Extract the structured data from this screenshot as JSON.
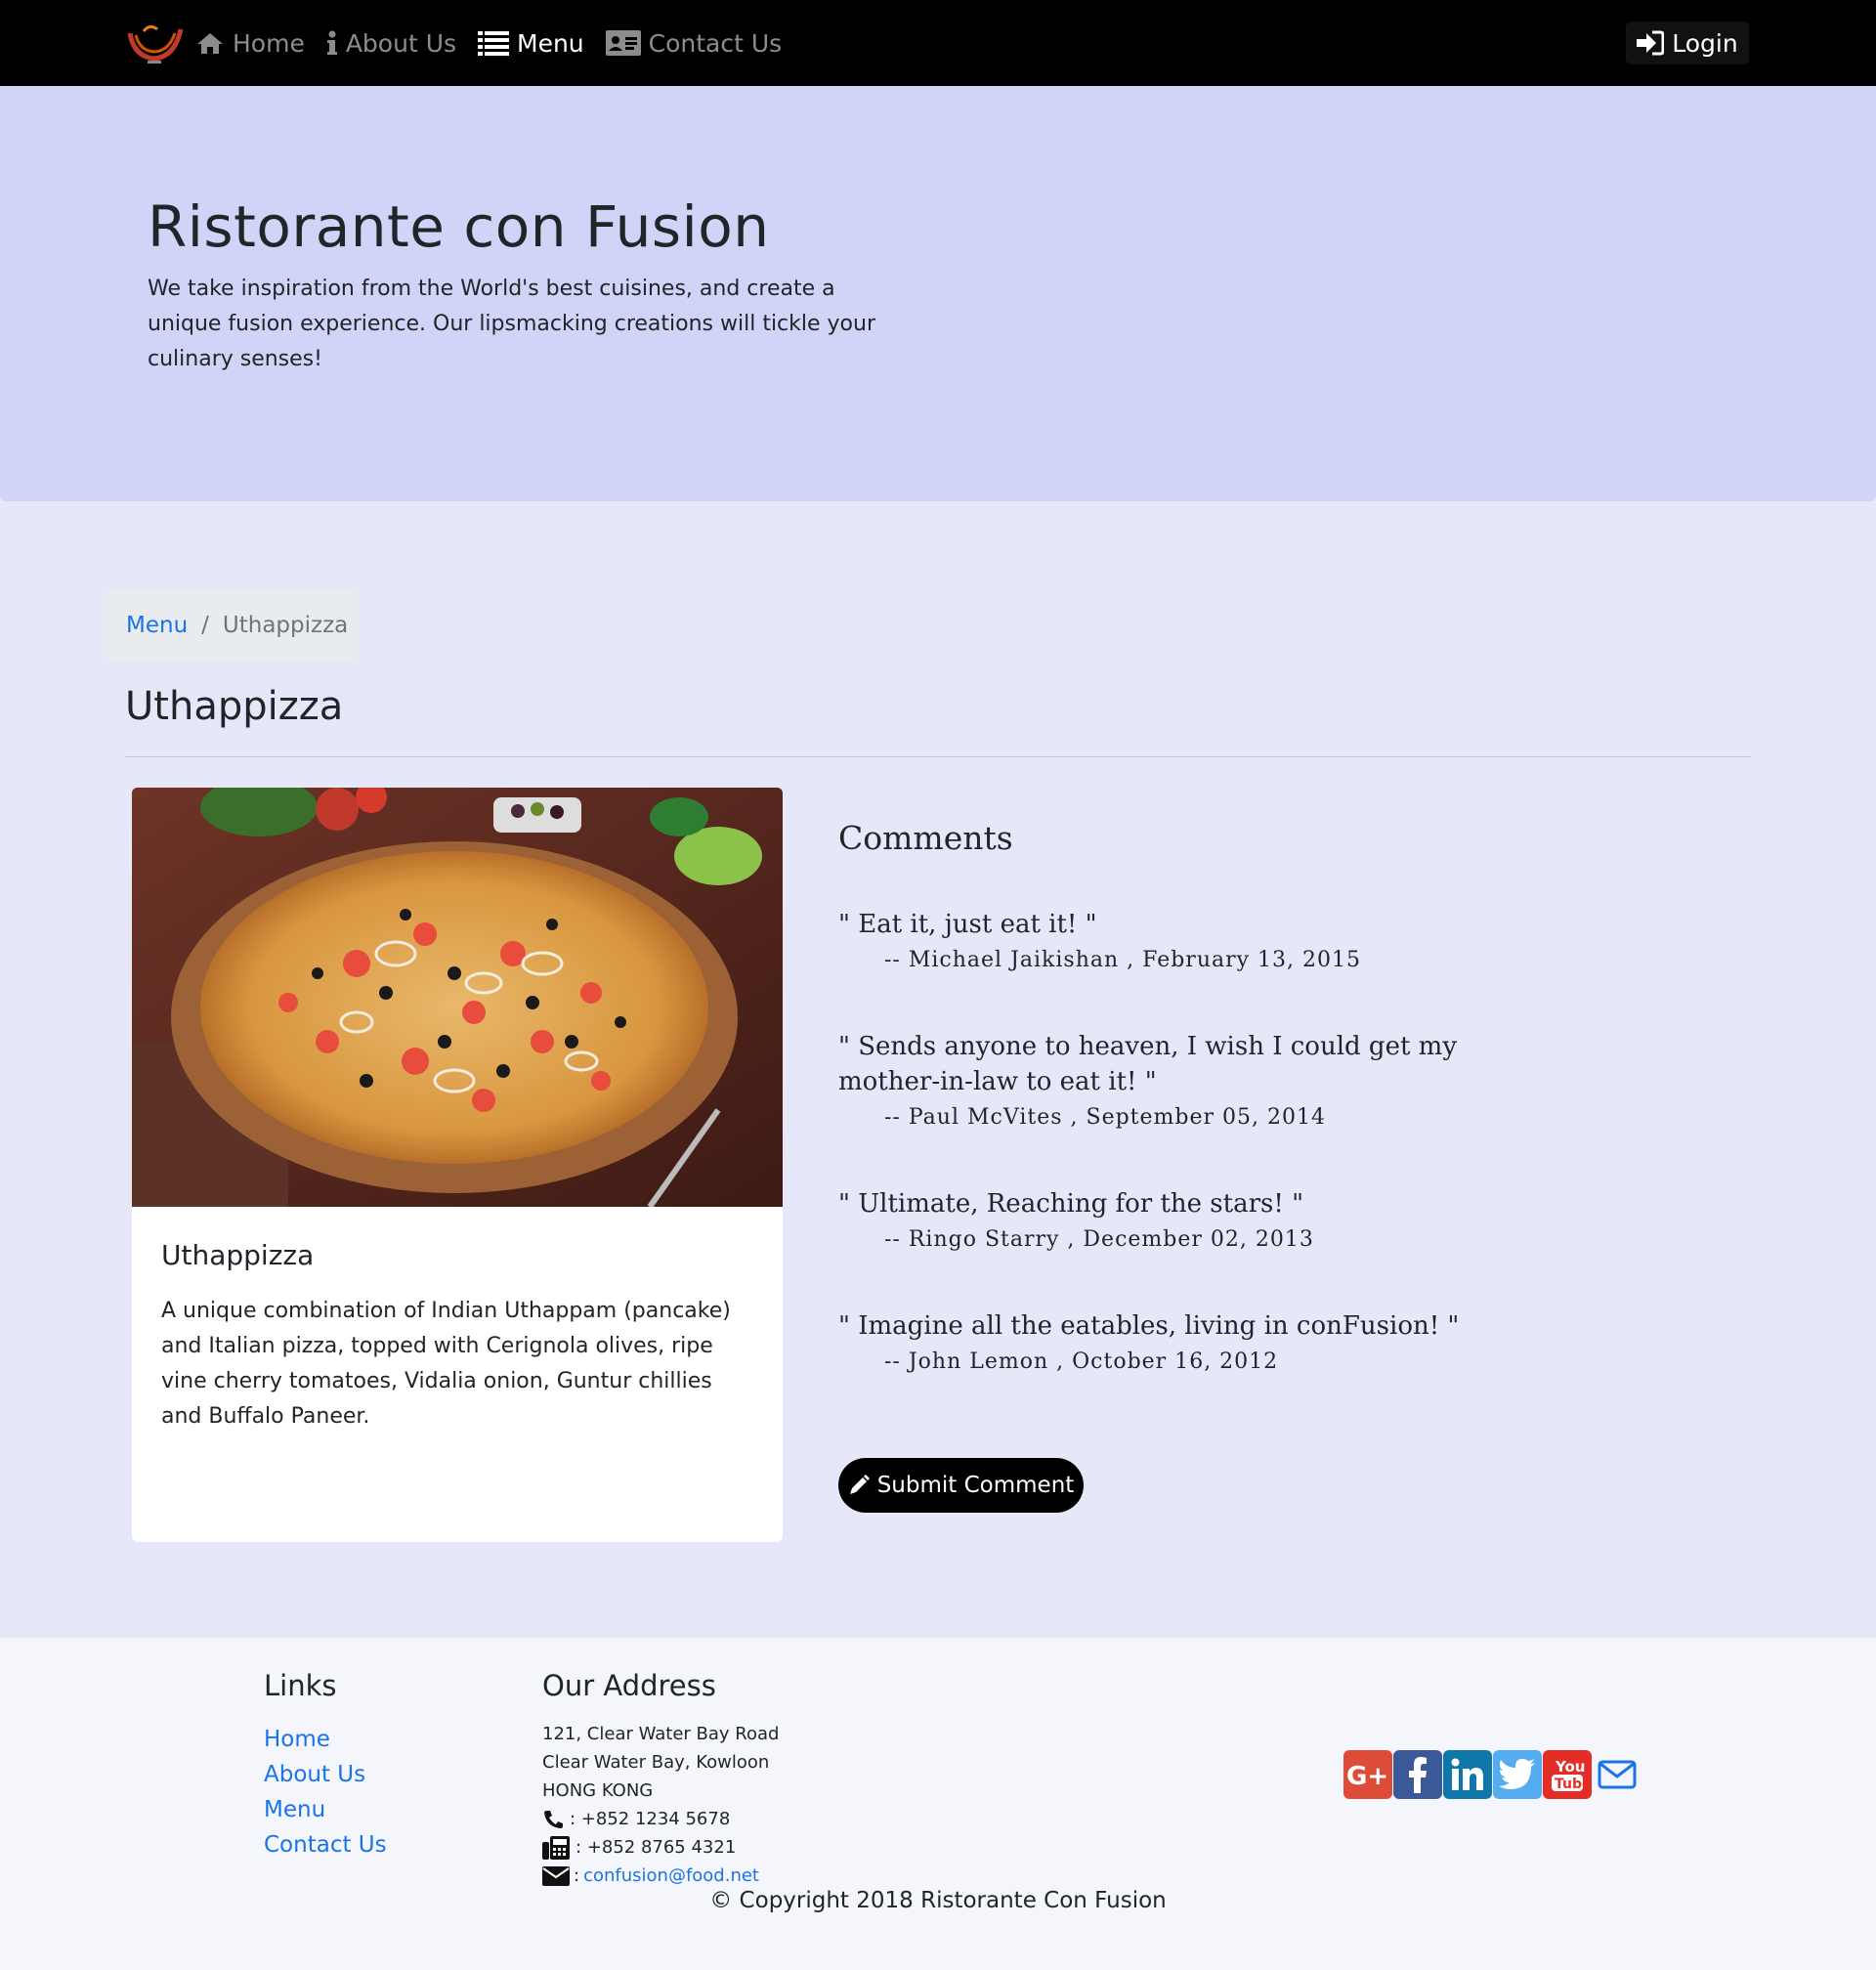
{
  "colors": {
    "navbar_bg": "#000000",
    "jumbotron_bg": "#d0d4f7",
    "page_bg": "#e6e8f9",
    "link": "#1a73e8",
    "footer_bg": "#f5f6fc"
  },
  "navbar": {
    "items": [
      {
        "label": "Home",
        "icon": "home-icon"
      },
      {
        "label": "About Us",
        "icon": "info-icon"
      },
      {
        "label": "Menu",
        "icon": "list-icon"
      },
      {
        "label": "Contact Us",
        "icon": "address-card-icon"
      }
    ],
    "active": "Menu",
    "login_label": "Login"
  },
  "jumbotron": {
    "title": "Ristorante con Fusion",
    "text": "We take inspiration from the World's best cuisines, and create a unique fusion experience. Our lipsmacking creations will tickle your culinary senses!"
  },
  "breadcrumb": {
    "parent": "Menu",
    "current": "Uthappizza"
  },
  "dish": {
    "heading": "Uthappizza",
    "card_title": "Uthappizza",
    "description": "A unique combination of Indian Uthappam (pancake) and Italian pizza, topped with Cerignola olives, ripe vine cherry tomatoes, Vidalia onion, Guntur chillies and Buffalo Paneer."
  },
  "comments": {
    "heading": "Comments",
    "items": [
      {
        "text": "\" Eat it, just eat it! \"",
        "meta": "-- Michael Jaikishan ,   February 13, 2015"
      },
      {
        "text": "\" Sends anyone to heaven, I wish I could get my mother-in-law to eat it! \"",
        "meta": "-- Paul McVites ,   September 05, 2014"
      },
      {
        "text": "\" Ultimate, Reaching for the stars! \"",
        "meta": "-- Ringo Starry ,   December 02, 2013"
      },
      {
        "text": "\" Imagine all the eatables, living in conFusion! \"",
        "meta": "-- John Lemon ,   October 16, 2012"
      }
    ],
    "submit_label": "Submit Comment"
  },
  "footer": {
    "links_heading": "Links",
    "links": [
      "Home",
      "About Us",
      "Menu",
      "Contact Us"
    ],
    "address_heading": "Our Address",
    "address_lines": [
      "121, Clear Water Bay Road",
      "Clear Water Bay, Kowloon",
      "HONG KONG"
    ],
    "phone": ": +852 1234 5678",
    "fax": ": +852 8765 4321",
    "email_prefix": ":",
    "email": "confusion@food.net",
    "social": [
      "google-plus-icon",
      "facebook-icon",
      "linkedin-icon",
      "twitter-icon",
      "youtube-icon",
      "envelope-icon"
    ],
    "copyright": "© Copyright 2018 Ristorante Con Fusion"
  }
}
